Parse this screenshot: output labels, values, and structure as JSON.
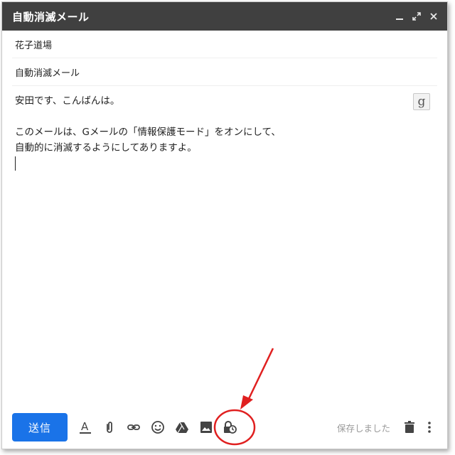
{
  "window": {
    "title": "自動消滅メール",
    "controls": [
      "minimize-icon",
      "expand-icon",
      "close-icon"
    ]
  },
  "fields": {
    "to": "花子道場",
    "subject": "自動消滅メール"
  },
  "body": {
    "lines": [
      "安田です、こんばんは。",
      "このメールは、Gメールの「情報保護モード」をオンにして、",
      "自動的に消滅するようにしてありますよ。"
    ]
  },
  "input_tools_button": "g",
  "toolbar": {
    "send_label": "送信",
    "icons": [
      "text-format-icon",
      "attach-icon",
      "link-icon",
      "emoji-icon",
      "drive-icon",
      "photo-icon",
      "confidential-mode-icon"
    ],
    "saved_status": "保存しました"
  },
  "colors": {
    "titlebar": "#404040",
    "send_button": "#1a73e8",
    "annotation": "#e02020"
  }
}
